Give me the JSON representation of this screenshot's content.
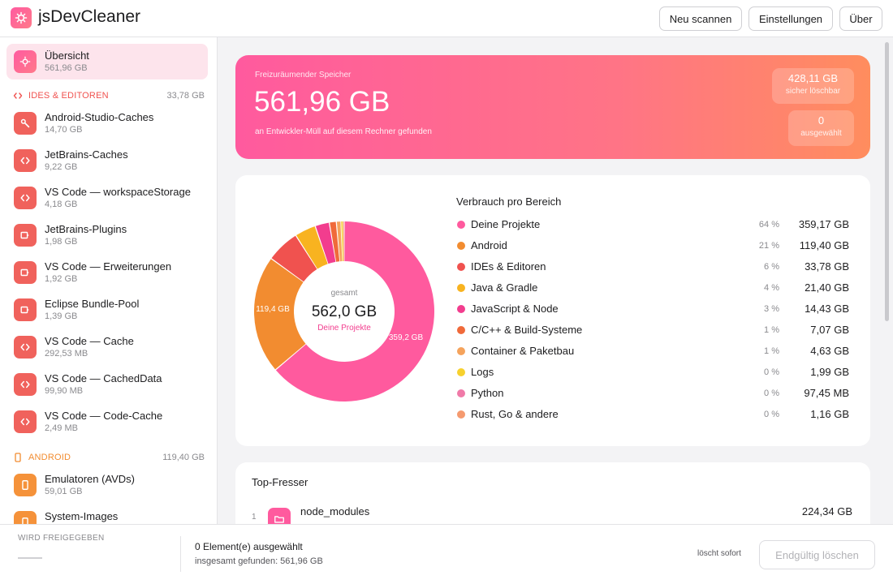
{
  "app": {
    "title": "jsDevCleaner"
  },
  "header": {
    "scan_label": "Neu scannen",
    "settings_label": "Einstellungen",
    "about_label": "Über"
  },
  "sidebar": {
    "overview": {
      "name": "Übersicht",
      "size": "561,96 GB"
    },
    "groups": [
      {
        "label": "IDES & EDITOREN",
        "size": "33,78 GB",
        "color": "#f0524f"
      },
      {
        "label": "ANDROID",
        "size": "119,40 GB",
        "color": "#f28c30"
      }
    ],
    "items": [
      {
        "name": "Android-Studio-Caches",
        "size": "14,70 GB",
        "icon": "wrench-icon"
      },
      {
        "name": "JetBrains-Caches",
        "size": "9,22 GB",
        "icon": "code-icon"
      },
      {
        "name": "VS Code — workspaceStorage",
        "size": "4,18 GB",
        "icon": "code-icon"
      },
      {
        "name": "JetBrains-Plugins",
        "size": "1,98 GB",
        "icon": "plugin-icon"
      },
      {
        "name": "VS Code — Erweiterungen",
        "size": "1,92 GB",
        "icon": "plugin-icon"
      },
      {
        "name": "Eclipse Bundle-Pool",
        "size": "1,39 GB",
        "icon": "plugin-icon"
      },
      {
        "name": "VS Code — Cache",
        "size": "292,53 MB",
        "icon": "code-icon"
      },
      {
        "name": "VS Code — CachedData",
        "size": "99,90 MB",
        "icon": "code-icon"
      },
      {
        "name": "VS Code — Code-Cache",
        "size": "2,49 MB",
        "icon": "code-icon"
      },
      {
        "name": "Emulatoren (AVDs)",
        "size": "59,01 GB",
        "icon": "phone-icon"
      },
      {
        "name": "System-Images",
        "size": "",
        "icon": "phone-icon"
      }
    ]
  },
  "hero": {
    "label": "Freizuräumender Speicher",
    "value": "561,96 GB",
    "sub": "an Entwickler-Müll auf diesem Rechner gefunden",
    "safe_value": "428,11 GB",
    "safe_label": "sicher löschbar",
    "selected_value": "0",
    "selected_label": "ausgewählt"
  },
  "usage": {
    "title": "Verbrauch pro Bereich",
    "center_label": "gesamt",
    "center_value": "562,0 GB",
    "center_sub": "Deine Projekte",
    "slice_labels": [
      {
        "text": "359,2 GB"
      },
      {
        "text": "119,4 GB"
      }
    ]
  },
  "chart_data": {
    "type": "pie",
    "title": "Verbrauch pro Bereich",
    "categories": [
      "Deine Projekte",
      "Android",
      "IDEs & Editoren",
      "Java & Gradle",
      "JavaScript & Node",
      "C/C++ & Build-Systeme",
      "Container & Paketbau",
      "Logs",
      "Python",
      "Rust, Go & andere"
    ],
    "values": [
      359.17,
      119.4,
      33.78,
      21.4,
      14.43,
      7.07,
      4.63,
      1.99,
      97.45,
      1.16
    ],
    "units": [
      "GB",
      "GB",
      "GB",
      "GB",
      "GB",
      "GB",
      "GB",
      "GB",
      "MB",
      "GB"
    ],
    "value_labels": [
      "359,17 GB",
      "119,40 GB",
      "33,78 GB",
      "21,40 GB",
      "14,43 GB",
      "7,07 GB",
      "4,63 GB",
      "1,99 GB",
      "97,45 MB",
      "1,16 GB"
    ],
    "percent_labels": [
      "64 %",
      "21 %",
      "6 %",
      "4 %",
      "3 %",
      "1 %",
      "1 %",
      "0 %",
      "0 %",
      "0 %"
    ],
    "colors": [
      "#ff5a9e",
      "#f28c30",
      "#f0524f",
      "#f8b320",
      "#f23d8e",
      "#f06a3a",
      "#f5a35c",
      "#f7d12e",
      "#f07aa8",
      "#f59a6f"
    ],
    "center_total": "562,0 GB"
  },
  "top": {
    "title": "Top-Fresser",
    "items": [
      {
        "rank": "1",
        "name": "node_modules",
        "size": "224,34 GB"
      }
    ]
  },
  "footer": {
    "freeing_label": "WIRD FREIGEGEBEN",
    "selected_text": "0 Element(e) ausgewählt",
    "total_text": "insgesamt gefunden: 561,96 GB",
    "note": "löscht sofort",
    "delete_label": "Endgültig löschen"
  }
}
